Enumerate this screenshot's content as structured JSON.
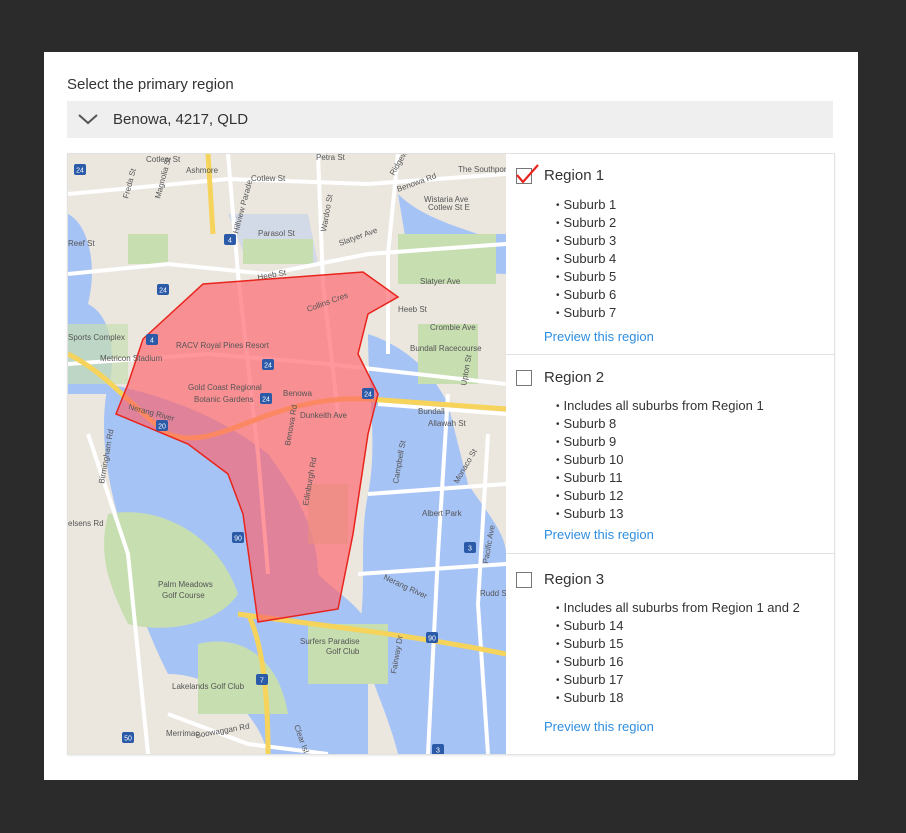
{
  "form": {
    "heading": "Select the primary region",
    "selected_location": "Benowa, 4217, QLD"
  },
  "map": {
    "labels": [
      "Cotlew St",
      "Petra St",
      "Ashmore",
      "Cotlew St",
      "Ridgeway Ave",
      "The Southport",
      "Benowa Rd",
      "Wistaria Ave",
      "Cotlew St E",
      "Freda St",
      "Magnolia St",
      "Hillview Parade",
      "Parasol St",
      "Wardoo St",
      "Slatyer Ave",
      "Reef St",
      "Heeb St",
      "Heeb St",
      "Slatyer Ave",
      "Collins Cres",
      "Crombie Ave",
      "Sports Complex",
      "RACV Royal Pines Resort",
      "Metricon Stadium",
      "Bundall Racecourse",
      "Upton St",
      "Gold Coast Regional",
      "Botanic Gardens",
      "Benowa",
      "Dunkeith Ave",
      "Bundall",
      "Nerang River",
      "Allawah St",
      "Birmingham Rd",
      "Benowa Rd",
      "Edinburgh Rd",
      "Campbell St",
      "Monaco St",
      "Albert Park",
      "Pacific Ave",
      "elsens Rd",
      "Palm Meadows",
      "Golf Course",
      "Nerang River",
      "Rudd St",
      "Surfers Paradise",
      "Golf Club",
      "Fairway Dr",
      "Lakelands Golf Club",
      "Merrimac",
      "Boowaggan Rd",
      "Clear Isl"
    ],
    "route_shields": [
      "24",
      "24",
      "4",
      "4",
      "24",
      "24",
      "24",
      "20",
      "90",
      "90",
      "7",
      "3",
      "3",
      "50"
    ],
    "colors": {
      "land": "#ebe7df",
      "water": "#a6c3f5",
      "park": "#c7deb1",
      "highway": "#f6d35a",
      "region_fill": "#ff5f68",
      "region_stroke": "#e8241c"
    }
  },
  "regions": [
    {
      "title": "Region 1",
      "checked": true,
      "items": [
        "Suburb 1",
        "Suburb 2",
        "Suburb 3",
        "Suburb 4",
        "Suburb 5",
        "Suburb 6",
        "Suburb 7"
      ],
      "preview_label": "Preview this region"
    },
    {
      "title": "Region 2",
      "checked": false,
      "items": [
        "Includes all suburbs from Region 1",
        "Suburb 8",
        "Suburb 9",
        "Suburb 10",
        "Suburb 11",
        "Suburb 12",
        "Suburb 13"
      ],
      "preview_label": "Preview this region"
    },
    {
      "title": "Region 3",
      "checked": false,
      "items": [
        "Includes all suburbs from Region 1 and 2",
        "Suburb 14",
        "Suburb 15",
        "Suburb 16",
        "Suburb 17",
        "Suburb 18"
      ],
      "preview_label": "Preview this region"
    }
  ]
}
